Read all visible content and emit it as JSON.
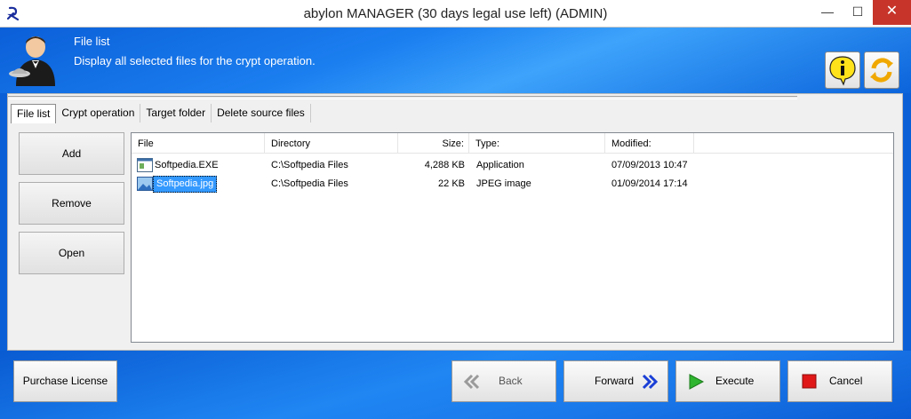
{
  "window": {
    "title": "abylon MANAGER (30 days legal use left) (ADMIN)",
    "minimize": "—",
    "maximize": "☐",
    "close": "✕"
  },
  "header": {
    "title": "File list",
    "subtitle": "Display all selected files for the crypt operation.",
    "info_button_icon": "info-icon",
    "refresh_button_icon": "refresh-icon"
  },
  "tabs": [
    {
      "label": "File list",
      "active": true
    },
    {
      "label": "Crypt operation"
    },
    {
      "label": "Target folder"
    },
    {
      "label": "Delete source files"
    }
  ],
  "side_buttons": {
    "add": "Add",
    "remove": "Remove",
    "open": "Open"
  },
  "list": {
    "columns": [
      "File",
      "Directory",
      "Size:",
      "Type:",
      "Modified:"
    ],
    "rows": [
      {
        "file": "Softpedia.EXE",
        "directory": "C:\\Softpedia Files",
        "size": "4,288 KB",
        "type": "Application",
        "modified": "07/09/2013 10:47",
        "selected": false
      },
      {
        "file": "Softpedia.jpg",
        "directory": "C:\\Softpedia Files",
        "size": "22 KB",
        "type": "JPEG image",
        "modified": "01/09/2014 17:14",
        "selected": true
      }
    ]
  },
  "footer": {
    "purchase": "Purchase License",
    "back": "Back",
    "forward": "Forward",
    "execute": "Execute",
    "cancel": "Cancel"
  },
  "colors": {
    "accent_blue": "#0a5fd6",
    "selection": "#3399ff",
    "close_red": "#c7352a",
    "execute_green": "#2fb52f",
    "cancel_red": "#e01818",
    "nav_arrow_blue": "#1a3fd6"
  }
}
